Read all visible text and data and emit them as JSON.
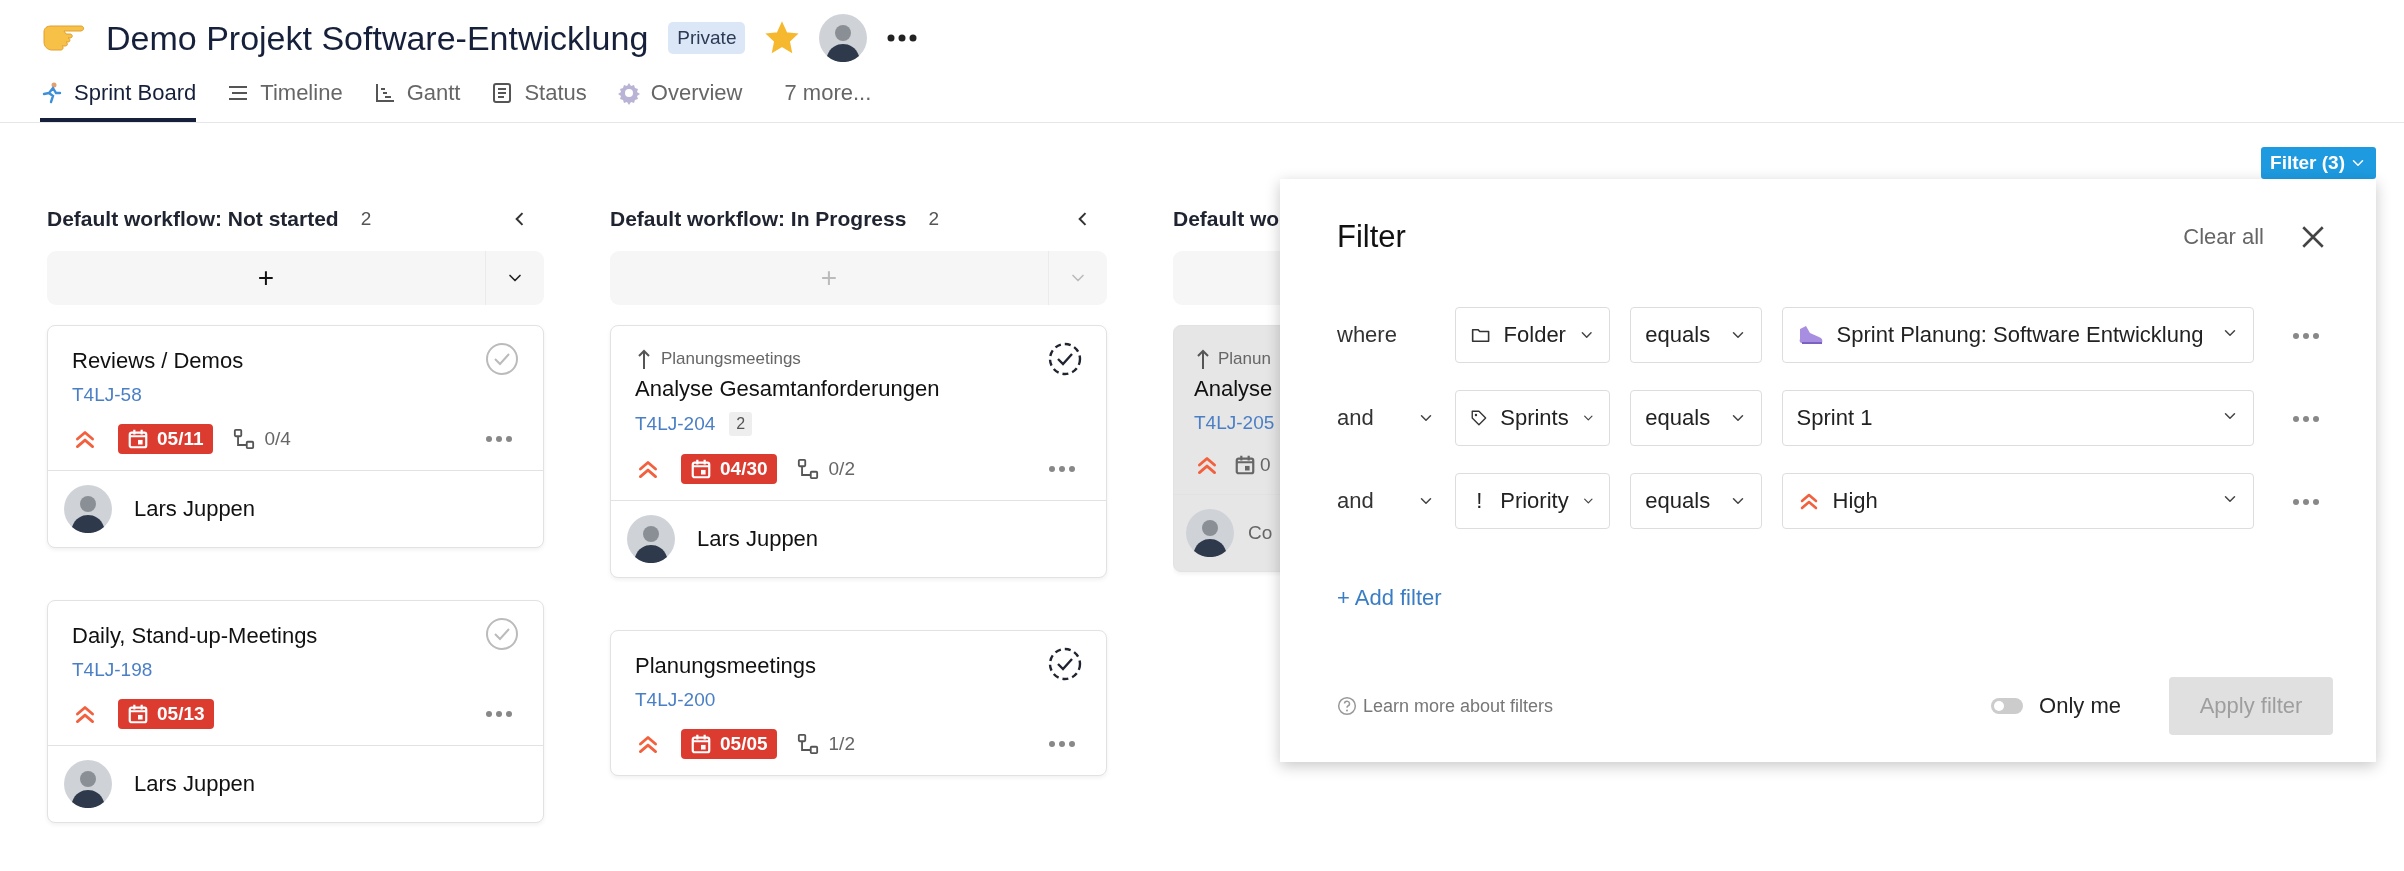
{
  "project": {
    "title": "Demo Projekt Software-Entwicklung",
    "badge": "Private",
    "starred": true
  },
  "tabs": [
    {
      "label": "Sprint Board",
      "selected": true
    },
    {
      "label": "Timeline",
      "selected": false
    },
    {
      "label": "Gantt",
      "selected": false
    },
    {
      "label": "Status",
      "selected": false
    },
    {
      "label": "Overview",
      "selected": false
    },
    {
      "label": "7 more...",
      "selected": false
    }
  ],
  "filter_button": "Filter (3)",
  "columns": [
    {
      "title": "Default workflow: Not started",
      "count": "2",
      "add_label": "+",
      "add_active": true,
      "cards": [
        {
          "title": "Reviews / Demos",
          "id": "T4LJ-58",
          "in_progress": false,
          "high_priority": true,
          "date": "05/11",
          "overdue": true,
          "subtasks": "0/4",
          "assignee": "Lars Juppen",
          "selected": false
        },
        {
          "title": "Daily, Stand-up-Meetings",
          "id": "T4LJ-198",
          "in_progress": false,
          "high_priority": true,
          "date": "05/13",
          "overdue": true,
          "assignee": "Lars Juppen",
          "selected": false
        }
      ]
    },
    {
      "title": "Default workflow: In Progress",
      "count": "2",
      "add_label": "+",
      "add_active": false,
      "cards": [
        {
          "parent": "Planungsmeetings",
          "title": "Analyse Gesamtanforderungen",
          "id": "T4LJ-204",
          "id_badge": "2",
          "in_progress": true,
          "high_priority": true,
          "date": "04/30",
          "overdue": true,
          "subtasks": "0/2",
          "assignee": "Lars Juppen",
          "selected": false
        },
        {
          "title": "Planungsmeetings",
          "id": "T4LJ-200",
          "in_progress": true,
          "high_priority": true,
          "date": "05/05",
          "overdue": true,
          "subtasks": "1/2",
          "selected": false
        }
      ]
    },
    {
      "title": "Default wo",
      "cards": [
        {
          "parent": "Planun",
          "title": "Analyse",
          "id": "T4LJ-205",
          "high_priority": true,
          "date": "0",
          "overdue": false,
          "assignee": "Co",
          "selected": true
        }
      ]
    }
  ],
  "filter": {
    "title": "Filter",
    "clear": "Clear all",
    "rows": [
      {
        "kind": "folder",
        "conjunction": "where",
        "conj_dropdown": false,
        "field": "Folder",
        "operator": "equals",
        "value": "Sprint Planung: Software Entwicklung"
      },
      {
        "kind": "tag",
        "conjunction": "and",
        "conj_dropdown": true,
        "field": "Sprints",
        "operator": "equals",
        "value": "Sprint 1"
      },
      {
        "kind": "priority",
        "conjunction": "and",
        "conj_dropdown": true,
        "field": "Priority",
        "field_mark": "!",
        "operator": "equals",
        "value": "High"
      }
    ],
    "add_filter": "+ Add filter",
    "help": "Learn more about filters",
    "only_me": {
      "label": "Only me",
      "on": false
    },
    "apply": {
      "label": "Apply filter",
      "disabled": true
    }
  }
}
